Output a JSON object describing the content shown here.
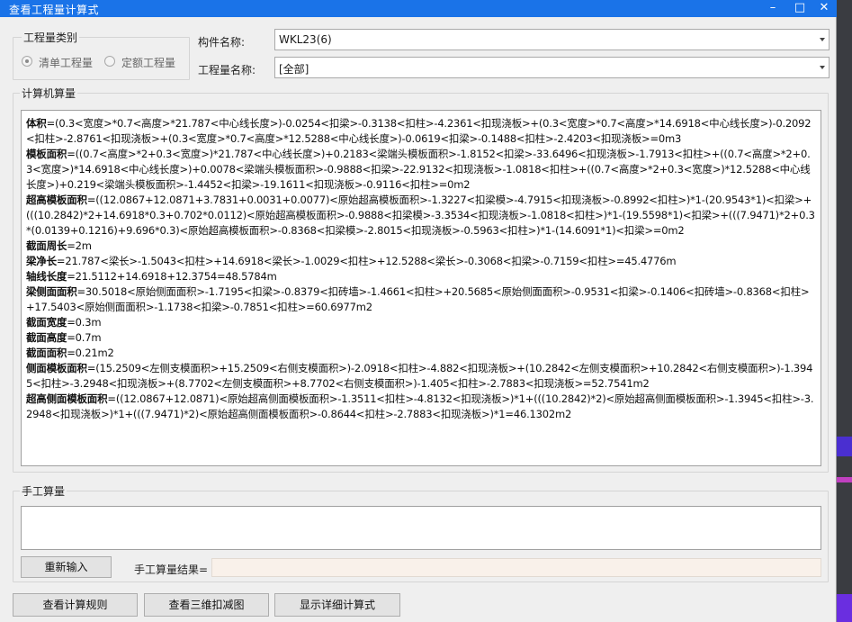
{
  "window": {
    "title": "查看工程量计算式",
    "minimize_glyph": "–",
    "maximize_glyph": "□",
    "close_glyph": "✕"
  },
  "category_group": {
    "label": "工程量类别",
    "options": [
      {
        "label": "清单工程量",
        "checked": true
      },
      {
        "label": "定额工程量",
        "checked": false
      }
    ]
  },
  "component": {
    "label": "构件名称:",
    "value": "WKL23(6)"
  },
  "quantity_name": {
    "label": "工程量名称:",
    "value": "[全部]"
  },
  "computer_calc": {
    "label": "计算机算量",
    "lines": [
      {
        "name": "体积",
        "expr": "=(0.3<宽度>*0.7<高度>*21.787<中心线长度>)-0.0254<扣梁>-0.3138<扣柱>-4.2361<扣现浇板>+(0.3<宽度>*0.7<高度>*14.6918<中心线长度>)-0.2092<扣柱>-2.8761<扣现浇板>+(0.3<宽度>*0.7<高度>*12.5288<中心线长度>)-0.0619<扣梁>-0.1488<扣柱>-2.4203<扣现浇板>=0m3"
      },
      {
        "name": "模板面积",
        "expr": "=((0.7<高度>*2+0.3<宽度>)*21.787<中心线长度>)+0.2183<梁端头模板面积>-1.8152<扣梁>-33.6496<扣现浇板>-1.7913<扣柱>+((0.7<高度>*2+0.3<宽度>)*14.6918<中心线长度>)+0.0078<梁端头模板面积>-0.9888<扣梁>-22.9132<扣现浇板>-1.0818<扣柱>+((0.7<高度>*2+0.3<宽度>)*12.5288<中心线长度>)+0.219<梁端头模板面积>-1.4452<扣梁>-19.1611<扣现浇板>-0.9116<扣柱>=0m2"
      },
      {
        "name": "超高模板面积",
        "expr": "=((12.0867+12.0871+3.7831+0.0031+0.0077)<原始超高模板面积>-1.3227<扣梁模>-4.7915<扣现浇板>-0.8992<扣柱>)*1-(20.9543*1)<扣梁>+(((10.2842)*2+14.6918*0.3+0.702*0.0112)<原始超高模板面积>-0.9888<扣梁模>-3.3534<扣现浇板>-1.0818<扣柱>)*1-(19.5598*1)<扣梁>+(((7.9471)*2+0.3*(0.0139+0.1216)+9.696*0.3)<原始超高模板面积>-0.8368<扣梁模>-2.8015<扣现浇板>-0.5963<扣柱>)*1-(14.6091*1)<扣梁>=0m2"
      },
      {
        "name": "截面周长",
        "expr": "=2m"
      },
      {
        "name": "梁净长",
        "expr": "=21.787<梁长>-1.5043<扣柱>+14.6918<梁长>-1.0029<扣柱>+12.5288<梁长>-0.3068<扣梁>-0.7159<扣柱>=45.4776m"
      },
      {
        "name": "轴线长度",
        "expr": "=21.5112+14.6918+12.3754=48.5784m"
      },
      {
        "name": "梁侧面面积",
        "expr": "=30.5018<原始侧面面积>-1.7195<扣梁>-0.8379<扣砖墙>-1.4661<扣柱>+20.5685<原始侧面面积>-0.9531<扣梁>-0.1406<扣砖墙>-0.8368<扣柱>+17.5403<原始侧面面积>-1.1738<扣梁>-0.7851<扣柱>=60.6977m2"
      },
      {
        "name": "截面宽度",
        "expr": "=0.3m"
      },
      {
        "name": "截面高度",
        "expr": "=0.7m"
      },
      {
        "name": "截面面积",
        "expr": "=0.21m2"
      },
      {
        "name": "侧面模板面积",
        "expr": "=(15.2509<左侧支模面积>+15.2509<右侧支模面积>)-2.0918<扣柱>-4.882<扣现浇板>+(10.2842<左侧支模面积>+10.2842<右侧支模面积>)-1.3945<扣柱>-3.2948<扣现浇板>+(8.7702<左侧支模面积>+8.7702<右侧支模面积>)-1.405<扣柱>-2.7883<扣现浇板>=52.7541m2"
      },
      {
        "name": "超高侧面模板面积",
        "expr": "=((12.0867+12.0871)<原始超高侧面模板面积>-1.3511<扣柱>-4.8132<扣现浇板>)*1+(((10.2842)*2)<原始超高侧面模板面积>-1.3945<扣柱>-3.2948<扣现浇板>)*1+(((7.9471)*2)<原始超高侧面模板面积>-0.8644<扣柱>-2.7883<扣现浇板>)*1=46.1302m2"
      }
    ]
  },
  "manual_calc": {
    "label": "手工算量",
    "value": "",
    "reinput_button": "重新输入",
    "result_label": "手工算量结果=",
    "result_value": ""
  },
  "footer_buttons": {
    "view_rules": "查看计算规则",
    "view_3d": "查看三维扣减图",
    "show_detail": "显示详细计算式"
  }
}
